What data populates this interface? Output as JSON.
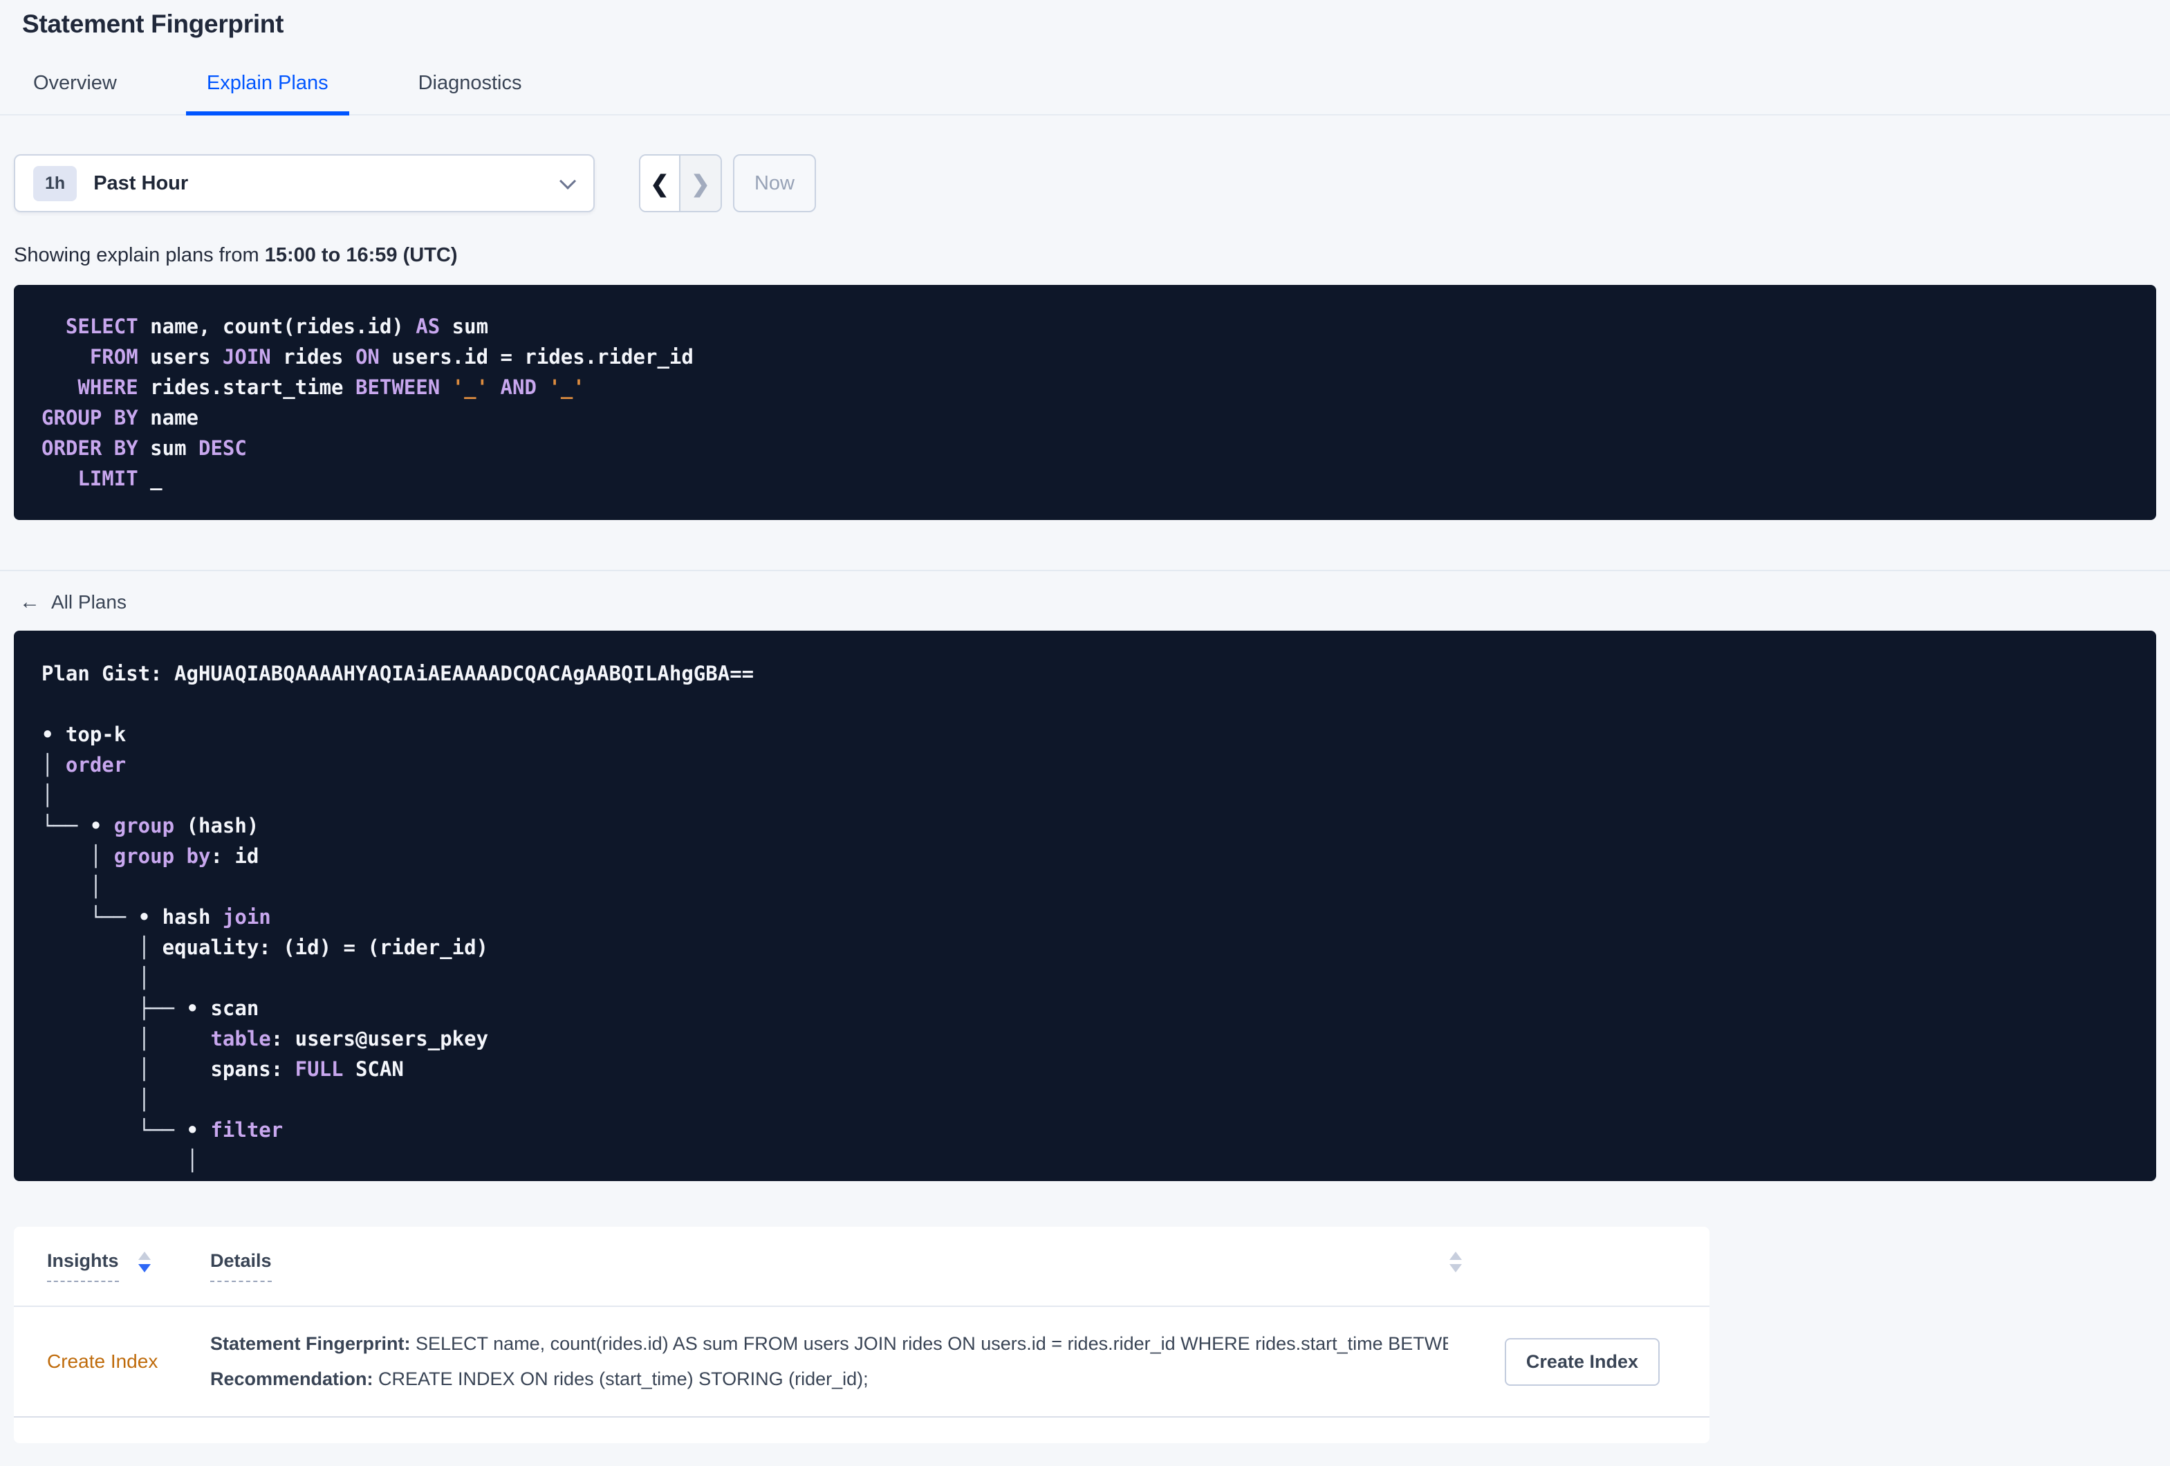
{
  "page": {
    "title": "Statement Fingerprint"
  },
  "tabs": [
    {
      "label": "Overview"
    },
    {
      "label": "Explain Plans"
    },
    {
      "label": "Diagnostics"
    }
  ],
  "time_picker": {
    "range_badge": "1h",
    "range_label": "Past Hour",
    "chevron_icon": "chevron-down-icon",
    "prev_icon": "❮",
    "next_icon": "❯",
    "now_label": "Now"
  },
  "showing": {
    "prefix": "Showing explain plans from ",
    "range_bold": "15:00 to 16:59 (UTC)"
  },
  "sql": {
    "lines": [
      [
        {
          "c": "p",
          "t": "  "
        },
        {
          "c": "k",
          "t": "SELECT"
        },
        {
          "c": "p",
          "t": " name, count(rides.id) "
        },
        {
          "c": "k",
          "t": "AS"
        },
        {
          "c": "p",
          "t": " sum"
        }
      ],
      [
        {
          "c": "p",
          "t": "    "
        },
        {
          "c": "k",
          "t": "FROM"
        },
        {
          "c": "p",
          "t": " users "
        },
        {
          "c": "k",
          "t": "JOIN"
        },
        {
          "c": "p",
          "t": " rides "
        },
        {
          "c": "k",
          "t": "ON"
        },
        {
          "c": "p",
          "t": " users.id = rides.rider_id"
        }
      ],
      [
        {
          "c": "p",
          "t": "   "
        },
        {
          "c": "k",
          "t": "WHERE"
        },
        {
          "c": "p",
          "t": " rides.start_time "
        },
        {
          "c": "k",
          "t": "BETWEEN"
        },
        {
          "c": "p",
          "t": " "
        },
        {
          "c": "s",
          "t": "'_'"
        },
        {
          "c": "p",
          "t": " "
        },
        {
          "c": "k",
          "t": "AND"
        },
        {
          "c": "p",
          "t": " "
        },
        {
          "c": "s",
          "t": "'_'"
        }
      ],
      [
        {
          "c": "k",
          "t": "GROUP BY"
        },
        {
          "c": "p",
          "t": " name"
        }
      ],
      [
        {
          "c": "k",
          "t": "ORDER BY"
        },
        {
          "c": "p",
          "t": " sum "
        },
        {
          "c": "k",
          "t": "DESC"
        }
      ],
      [
        {
          "c": "p",
          "t": "   "
        },
        {
          "c": "k",
          "t": "LIMIT"
        },
        {
          "c": "p",
          "t": " _"
        }
      ]
    ]
  },
  "all_plans": {
    "arrow_icon": "←",
    "label": "All Plans"
  },
  "plan": {
    "lines": [
      [
        {
          "c": "p",
          "t": "Plan Gist: AgHUAQIABQAAAAHYAQIAiAEAAAADCQACAgAABQILAhgGBA=="
        }
      ],
      [],
      [
        {
          "c": "p",
          "t": "• top-k"
        }
      ],
      [
        {
          "c": "br",
          "t": "│ "
        },
        {
          "c": "k",
          "t": "order"
        }
      ],
      [
        {
          "c": "br",
          "t": "│"
        }
      ],
      [
        {
          "c": "br",
          "t": "└── "
        },
        {
          "c": "p",
          "t": "• "
        },
        {
          "c": "k",
          "t": "group"
        },
        {
          "c": "p",
          "t": " (hash)"
        }
      ],
      [
        {
          "c": "p",
          "t": "    "
        },
        {
          "c": "br",
          "t": "│ "
        },
        {
          "c": "k",
          "t": "group by"
        },
        {
          "c": "p",
          "t": ": id"
        }
      ],
      [
        {
          "c": "p",
          "t": "    "
        },
        {
          "c": "br",
          "t": "│"
        }
      ],
      [
        {
          "c": "p",
          "t": "    "
        },
        {
          "c": "br",
          "t": "└── "
        },
        {
          "c": "p",
          "t": "• hash "
        },
        {
          "c": "k",
          "t": "join"
        }
      ],
      [
        {
          "c": "p",
          "t": "        "
        },
        {
          "c": "br",
          "t": "│ "
        },
        {
          "c": "p",
          "t": "equality: (id) = (rider_id)"
        }
      ],
      [
        {
          "c": "p",
          "t": "        "
        },
        {
          "c": "br",
          "t": "│"
        }
      ],
      [
        {
          "c": "p",
          "t": "        "
        },
        {
          "c": "br",
          "t": "├── "
        },
        {
          "c": "p",
          "t": "• scan"
        }
      ],
      [
        {
          "c": "p",
          "t": "        "
        },
        {
          "c": "br",
          "t": "│     "
        },
        {
          "c": "k",
          "t": "table"
        },
        {
          "c": "p",
          "t": ": users@users_pkey"
        }
      ],
      [
        {
          "c": "p",
          "t": "        "
        },
        {
          "c": "br",
          "t": "│     "
        },
        {
          "c": "p",
          "t": "spans: "
        },
        {
          "c": "k",
          "t": "FULL"
        },
        {
          "c": "p",
          "t": " SCAN"
        }
      ],
      [
        {
          "c": "p",
          "t": "        "
        },
        {
          "c": "br",
          "t": "│"
        }
      ],
      [
        {
          "c": "p",
          "t": "        "
        },
        {
          "c": "br",
          "t": "└── "
        },
        {
          "c": "p",
          "t": "• "
        },
        {
          "c": "k",
          "t": "filter"
        }
      ],
      [
        {
          "c": "p",
          "t": "            "
        },
        {
          "c": "br",
          "t": "│"
        }
      ]
    ]
  },
  "insights_table": {
    "columns": [
      "Insights",
      "Details"
    ],
    "rows": [
      {
        "insight": "Create Index",
        "fingerprint_label": "Statement Fingerprint: ",
        "fingerprint_text": "SELECT name, count(rides.id) AS sum FROM users JOIN rides ON users.id = rides.rider_id WHERE rides.start_time BETWEEN '_…",
        "recommendation_label": "Recommendation: ",
        "recommendation_text": "CREATE INDEX ON rides (start_time) STORING (rider_id);",
        "action_label": "Create Index"
      }
    ]
  },
  "colors": {
    "accent_blue": "#0055FF",
    "insight_orange": "#BF6B0B",
    "code_background": "#0E1729",
    "keyword_purple": "#C8A7EE",
    "string_orange": "#DD8C3F",
    "page_background": "#F5F7FA"
  }
}
